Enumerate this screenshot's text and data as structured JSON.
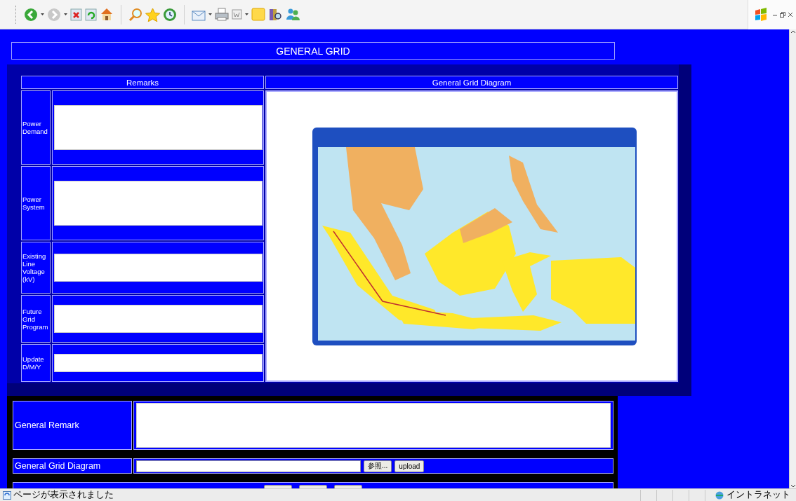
{
  "page": {
    "title": "GENERAL GRID"
  },
  "remarks_table": {
    "columns": [
      "Remarks",
      "General Grid Diagram"
    ],
    "rows": [
      {
        "label": "Power Demand"
      },
      {
        "label": "Power System"
      },
      {
        "label": "Existing Line Voltage (kV)"
      },
      {
        "label": "Future Grid Program"
      },
      {
        "label": "Update D/M/Y"
      }
    ],
    "diagram": {
      "kind": "picture"
    }
  },
  "general_remark": {
    "label": "General Remark"
  },
  "upload": {
    "label": "General Grid Diagram",
    "browse_button": "参照...",
    "upload_button": "upload"
  },
  "status_bar": {
    "message": "ページが表示されました",
    "zone": "イントラネット"
  }
}
